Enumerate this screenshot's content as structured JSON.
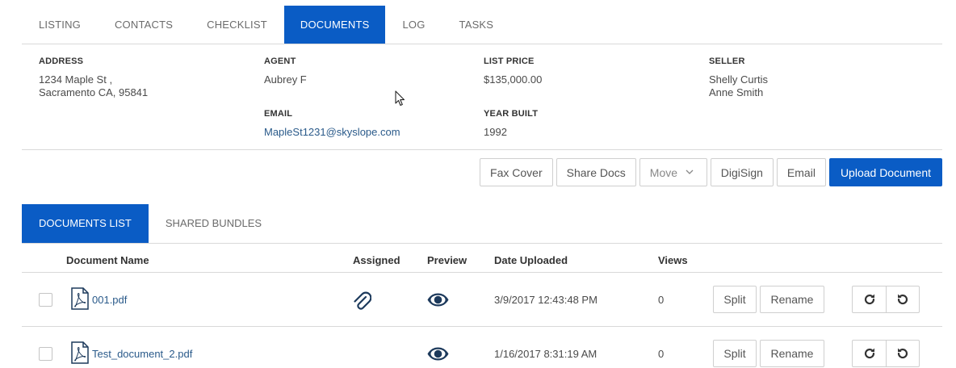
{
  "tabs": [
    "LISTING",
    "CONTACTS",
    "CHECKLIST",
    "DOCUMENTS",
    "LOG",
    "TASKS"
  ],
  "active_tab": "DOCUMENTS",
  "info": {
    "address_label": "ADDRESS",
    "address_line1": "1234 Maple St ,",
    "address_line2": "Sacramento CA, 95841",
    "agent_label": "AGENT",
    "agent_value": "Aubrey F",
    "email_label": "EMAIL",
    "email_value": "MapleSt1231@skyslope.com",
    "price_label": "LIST PRICE",
    "price_value": "$135,000.00",
    "year_label": "YEAR BUILT",
    "year_value": "1992",
    "seller_label": "SELLER",
    "seller_line1": "Shelly Curtis",
    "seller_line2": "Anne Smith"
  },
  "actions": {
    "fax_cover": "Fax Cover",
    "share_docs": "Share Docs",
    "move": "Move",
    "digisign": "DigiSign",
    "email": "Email",
    "upload": "Upload Document"
  },
  "sub_tabs": [
    "DOCUMENTS LIST",
    "SHARED BUNDLES"
  ],
  "table": {
    "headers": {
      "name": "Document Name",
      "assigned": "Assigned",
      "preview": "Preview",
      "date": "Date Uploaded",
      "views": "Views"
    },
    "rows": [
      {
        "name": "001.pdf",
        "assigned": true,
        "date": "3/9/2017 12:43:48 PM",
        "views": "0",
        "split": "Split",
        "rename": "Rename"
      },
      {
        "name": "Test_document_2.pdf",
        "assigned": false,
        "date": "1/16/2017 8:31:19 AM",
        "views": "0",
        "split": "Split",
        "rename": "Rename"
      }
    ]
  },
  "colors": {
    "accent": "#0a5cc5",
    "icon": "#1d3a5c",
    "link": "#2a5a8a"
  },
  "icons": [
    "pdf-file-icon",
    "paperclip-icon",
    "eye-icon",
    "rotate-right-icon",
    "rotate-left-icon",
    "chevron-down-icon",
    "mouse-cursor-icon"
  ]
}
